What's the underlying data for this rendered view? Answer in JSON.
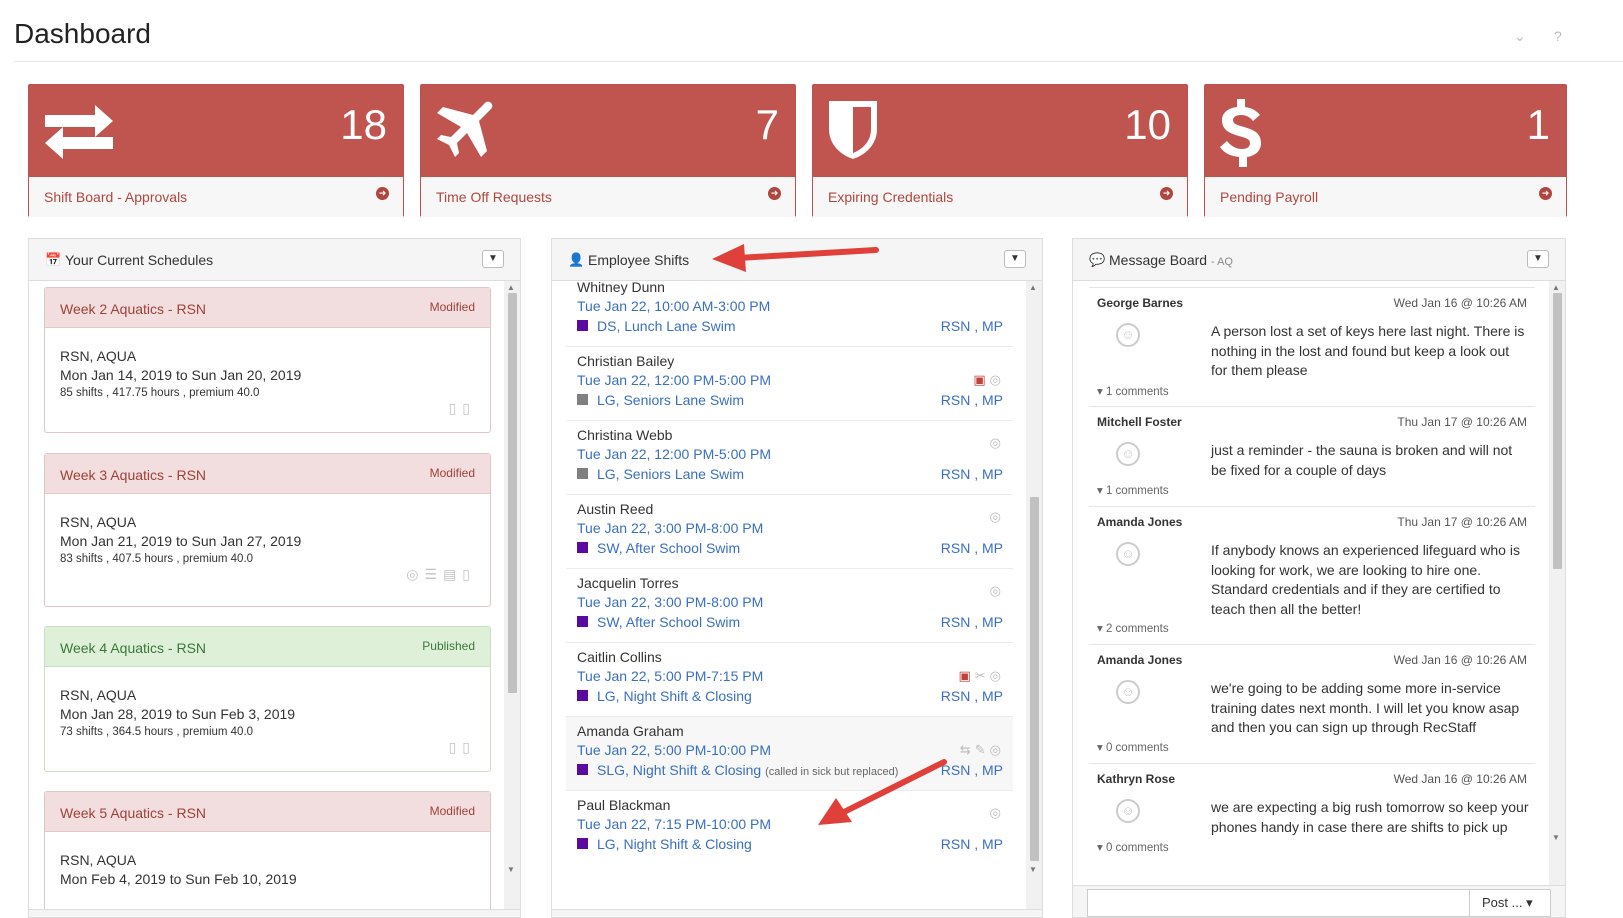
{
  "page": {
    "title": "Dashboard",
    "chevron_icon": "chevron-down-icon",
    "help_label": "?"
  },
  "tiles": [
    {
      "icon": "exchange-arrows-icon",
      "count": "18",
      "label": "Shift Board - Approvals"
    },
    {
      "icon": "airplane-icon",
      "count": "7",
      "label": "Time Off Requests"
    },
    {
      "icon": "shield-icon",
      "count": "10",
      "label": "Expiring Credentials"
    },
    {
      "icon": "dollar-icon",
      "count": "1",
      "label": "Pending Payroll"
    }
  ],
  "schedules_panel": {
    "title": "Your Current Schedules",
    "icon": "calendar-icon",
    "items": [
      {
        "name": "Week 2 Aquatics - RSN",
        "status": "Modified",
        "location": "RSN, AQUA",
        "dates": "Mon Jan 14, 2019 to Sun Jan 20, 2019",
        "stats": "85 shifts , 417.75 hours , premium 40.0"
      },
      {
        "name": "Week 3 Aquatics - RSN",
        "status": "Modified",
        "location": "RSN, AQUA",
        "dates": "Mon Jan 21, 2019 to Sun Jan 27, 2019",
        "stats": "83 shifts , 407.5 hours , premium 40.0"
      },
      {
        "name": "Week 4 Aquatics - RSN",
        "status": "Published",
        "location": "RSN, AQUA",
        "dates": "Mon Jan 28, 2019 to Sun Feb 3, 2019",
        "stats": "73 shifts , 364.5 hours , premium 40.0"
      },
      {
        "name": "Week 5 Aquatics - RSN",
        "status": "Modified",
        "location": "RSN, AQUA",
        "dates": "Mon Feb 4, 2019 to Sun Feb 10, 2019",
        "stats": ""
      }
    ]
  },
  "shifts_panel": {
    "title": "Employee Shifts",
    "icon": "user-icon",
    "items": [
      {
        "name": "Whitney Dunn",
        "time": "Tue Jan 22, 10:00 AM-3:00 PM",
        "position": "DS, Lunch Lane Swim",
        "note": "",
        "loc": "RSN , MP",
        "color": "#5b0aa0"
      },
      {
        "name": "Christian Bailey",
        "time": "Tue Jan 22, 12:00 PM-5:00 PM",
        "position": "LG, Seniors Lane Swim",
        "note": "",
        "loc": "RSN , MP",
        "color": "#808080"
      },
      {
        "name": "Christina Webb",
        "time": "Tue Jan 22, 12:00 PM-5:00 PM",
        "position": "LG, Seniors Lane Swim",
        "note": "",
        "loc": "RSN , MP",
        "color": "#808080"
      },
      {
        "name": "Austin Reed",
        "time": "Tue Jan 22, 3:00 PM-8:00 PM",
        "position": "SW, After School Swim",
        "note": "",
        "loc": "RSN , MP",
        "color": "#5b0aa0"
      },
      {
        "name": "Jacquelin Torres",
        "time": "Tue Jan 22, 3:00 PM-8:00 PM",
        "position": "SW, After School Swim",
        "note": "",
        "loc": "RSN , MP",
        "color": "#5b0aa0"
      },
      {
        "name": "Caitlin Collins",
        "time": "Tue Jan 22, 5:00 PM-7:15 PM",
        "position": "LG, Night Shift & Closing",
        "note": "",
        "loc": "RSN , MP",
        "color": "#5b0aa0"
      },
      {
        "name": "Amanda Graham",
        "time": "Tue Jan 22, 5:00 PM-10:00 PM",
        "position": "SLG, Night Shift & Closing",
        "note": "(called in sick but replaced)",
        "loc": "RSN , MP",
        "color": "#5b0aa0"
      },
      {
        "name": "Paul Blackman",
        "time": "Tue Jan 22, 7:15 PM-10:00 PM",
        "position": "LG, Night Shift & Closing",
        "note": "",
        "loc": "RSN , MP",
        "color": "#5b0aa0"
      }
    ]
  },
  "messages_panel": {
    "title": "Message Board",
    "subtitle": "- AQ",
    "icon": "comment-icon",
    "post_label": "Post ...",
    "items": [
      {
        "author": "George Barnes",
        "date": "Wed Jan 16 @ 10:26 AM",
        "text": "A person lost a set of keys here last night. There is nothing in the lost and found but keep a look out for them please",
        "comments": "1 comments"
      },
      {
        "author": "Mitchell Foster",
        "date": "Thu Jan 17 @ 10:26 AM",
        "text": "just a reminder - the sauna is broken and will not be fixed for a couple of days",
        "comments": "1 comments"
      },
      {
        "author": "Amanda Jones",
        "date": "Thu Jan 17 @ 10:26 AM",
        "text": "If anybody knows an experienced lifeguard who is looking for work, we are looking to hire one. Standard credentials and if they are certified to teach then all the better!",
        "comments": "2 comments"
      },
      {
        "author": "Amanda Jones",
        "date": "Wed Jan 16 @ 10:26 AM",
        "text": "we're going to be adding some more in-service training dates next month. I will let you know asap and then you can sign up through RecStaff",
        "comments": "0 comments"
      },
      {
        "author": "Kathryn Rose",
        "date": "Wed Jan 16 @ 10:26 AM",
        "text": "we are expecting a big rush tomorrow so keep your phones handy in case there are shifts to pick up",
        "comments": "0 comments"
      }
    ]
  },
  "colors": {
    "tile_red": "#c0554f",
    "link_blue": "#3a6fc0",
    "annotation_arrow": "#e0403a"
  }
}
